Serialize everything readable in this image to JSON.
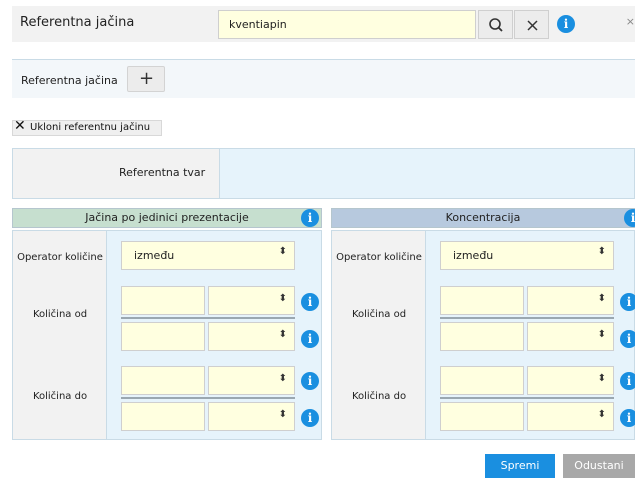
{
  "dialog": {
    "title": "Referentna jačina",
    "close_glyph": "×"
  },
  "ref_bar": {
    "label": "Referentna jačina",
    "add_glyph": "+"
  },
  "remove": {
    "label": "Ukloni referentnu jačinu"
  },
  "tvar": {
    "label": "Referentna tvar",
    "value": "kventiapin"
  },
  "left_panel": {
    "title": "Jačina po jedinici prezentacije",
    "operator_label": "Operator količine",
    "operator_value": "između",
    "from_label": "Količina od",
    "to_label": "Količina do"
  },
  "right_panel": {
    "title": "Koncentracija",
    "operator_label": "Operator količine",
    "operator_value": "između",
    "from_label": "Količina od",
    "to_label": "Količina do"
  },
  "buttons": {
    "save": "Spremi",
    "cancel": "Odustani"
  },
  "colors": {
    "accent": "#1a8fe0",
    "input_bg": "#ffffe0",
    "left_header": "#c6dfcf",
    "right_header": "#b7c9de"
  }
}
